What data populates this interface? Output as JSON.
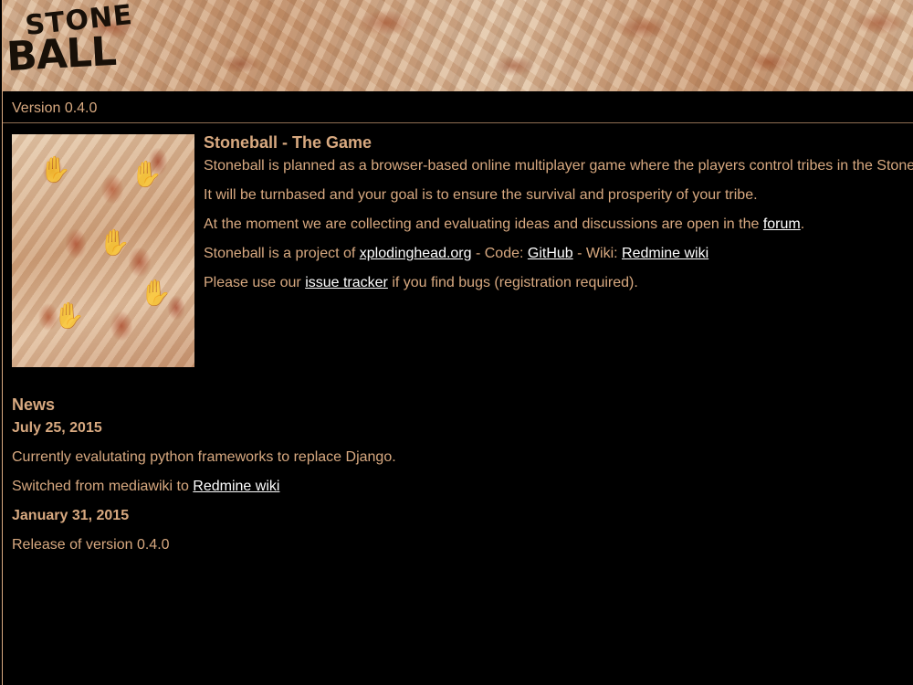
{
  "header": {
    "logo_line1": "STONE",
    "logo_line2": "BALL"
  },
  "version": "Version 0.4.0",
  "intro": {
    "image_icon": "cave-painting-hands-image",
    "title": "Stoneball - The Game",
    "line1": "Stoneball is planned as a browser-based online multiplayer game where the players control tribes in the Stone",
    "line2": "It will be turnbased and your goal is to ensure the survival and prosperity of your tribe.",
    "line3_before": "At the moment we are collecting and evaluating ideas and discussions are open in the ",
    "line3_link": "forum",
    "line3_after": ".",
    "line4_before": "Stoneball is a project of ",
    "line4_link1": "xplodinghead.org",
    "line4_mid1": " - Code: ",
    "line4_link2": "GitHub",
    "line4_mid2": " - Wiki: ",
    "line4_link3": "Redmine wiki",
    "line5_before": "Please use our ",
    "line5_link": "issue tracker",
    "line5_after": " if you find bugs (registration required)."
  },
  "news": {
    "heading": "News",
    "entries": [
      {
        "date": "July 25, 2015",
        "line1": "Currently evalutating python frameworks to replace Django.",
        "line2_before": "Switched from mediawiki to ",
        "line2_link": "Redmine wiki"
      },
      {
        "date": "January 31, 2015",
        "line1": "Release of version 0.4.0"
      }
    ]
  },
  "colors": {
    "background": "#000000",
    "text": "#d8a980",
    "link": "#ffffff"
  }
}
